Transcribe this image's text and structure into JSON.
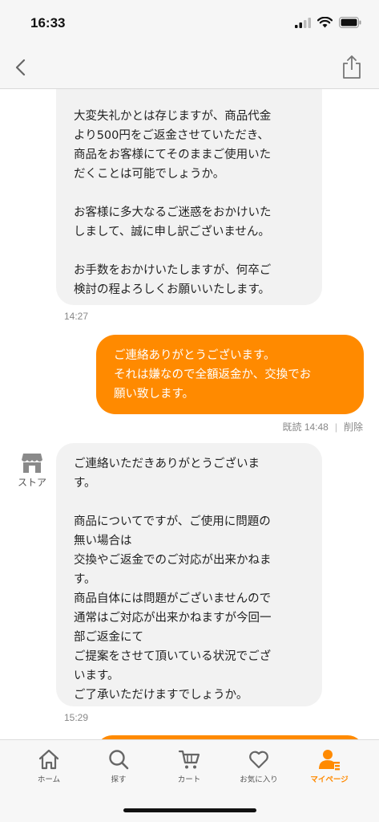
{
  "status_bar": {
    "time": "16:33"
  },
  "messages": [
    {
      "from": "store",
      "text": "大変失礼かとは存じますが、商品代金\nより500円をご返金させていただき、\n商品をお客様にてそのままご使用いた\nだくことは可能でしょうか。\n\nお客様に多大なるご迷惑をおかけいた\nしまして、誠に申し訳ございません。\n\nお手数をおかけいたしますが、何卒ご\n検討の程よろしくお願いいたします。",
      "time": "14:27"
    },
    {
      "from": "me",
      "text": "ご連絡ありがとうございます。\nそれは嫌なので全額返金か、交換でお\n願い致します。",
      "read_status": "既読 14:48",
      "delete_label": "削除"
    },
    {
      "from": "store",
      "sender_label": "ストア",
      "text": "ご連絡いただきありがとうございま\nす。\n\n商品についてですが、ご使用に問題の\n無い場合は\n交換やご返金でのご対応が出来かねま\nす。\n商品自体には問題がございませんので\n通常はご対応が出来かねますが今回一\n部ご返金にて\nご提案をさせて頂いている状況でござ\nいます。\nご了承いただけますでしょうか。",
      "time": "15:29"
    }
  ],
  "tab_bar": {
    "items": [
      {
        "label": "ホーム",
        "icon": "home-icon"
      },
      {
        "label": "探す",
        "icon": "search-icon"
      },
      {
        "label": "カート",
        "icon": "cart-icon"
      },
      {
        "label": "お気に入り",
        "icon": "heart-icon"
      },
      {
        "label": "マイページ",
        "icon": "person-icon",
        "active": true
      }
    ]
  },
  "colors": {
    "accent": "#ff8a00",
    "incoming_bubble": "#f2f2f2",
    "tab_inactive": "#555555"
  }
}
